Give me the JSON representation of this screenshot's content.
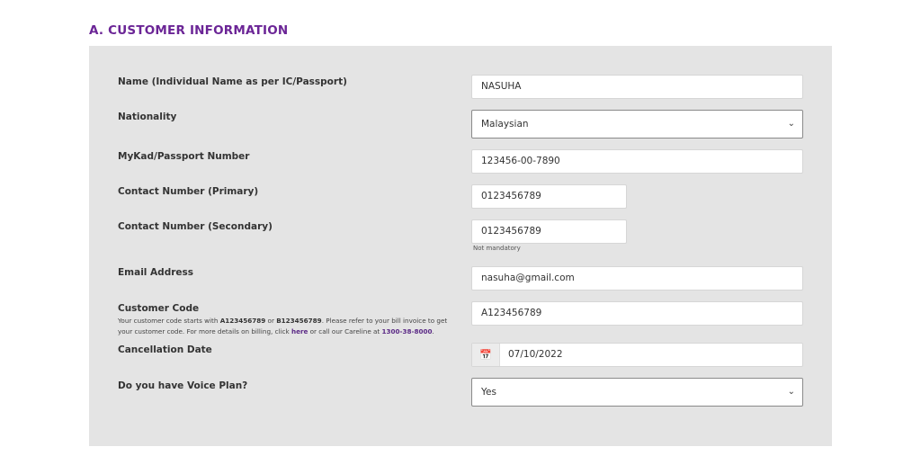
{
  "section_title": "A. CUSTOMER INFORMATION",
  "fields": [
    {
      "label": "Name (Individual Name as per IC/Passport)",
      "value": "NASUHA"
    },
    {
      "label": "Nationality",
      "value": "Malaysian"
    },
    {
      "label": "MyKad/Passport Number",
      "value": "123456-00-7890"
    },
    {
      "label": "Contact Number (Primary)",
      "value": "0123456789"
    },
    {
      "label": "Contact Number (Secondary)",
      "value": "0123456789",
      "note": "Not mandatory"
    },
    {
      "label": "Email Address",
      "value": "nasuha@gmail.com"
    },
    {
      "label": "Customer Code",
      "value": "A123456789"
    },
    {
      "label": "Cancellation Date",
      "value": "07/10/2022"
    },
    {
      "label": "Do you have Voice Plan?",
      "value": "Yes"
    }
  ],
  "customer_code_help": {
    "t1": "Your customer code starts with ",
    "c1": "A123456789",
    "t2": " or ",
    "c2": "B123456789",
    "t3": ". Please refer to your bill invoice to get your customer code. For more details on billing, click ",
    "link": "here",
    "t4": " or call our Careline at ",
    "phone": "1300-38-8000",
    "t5": "."
  },
  "icons": {
    "select": "chevron-down-icon",
    "date": "calendar-icon"
  },
  "colors": {
    "accent": "#6b2596",
    "panel": "#e4e4e4"
  }
}
